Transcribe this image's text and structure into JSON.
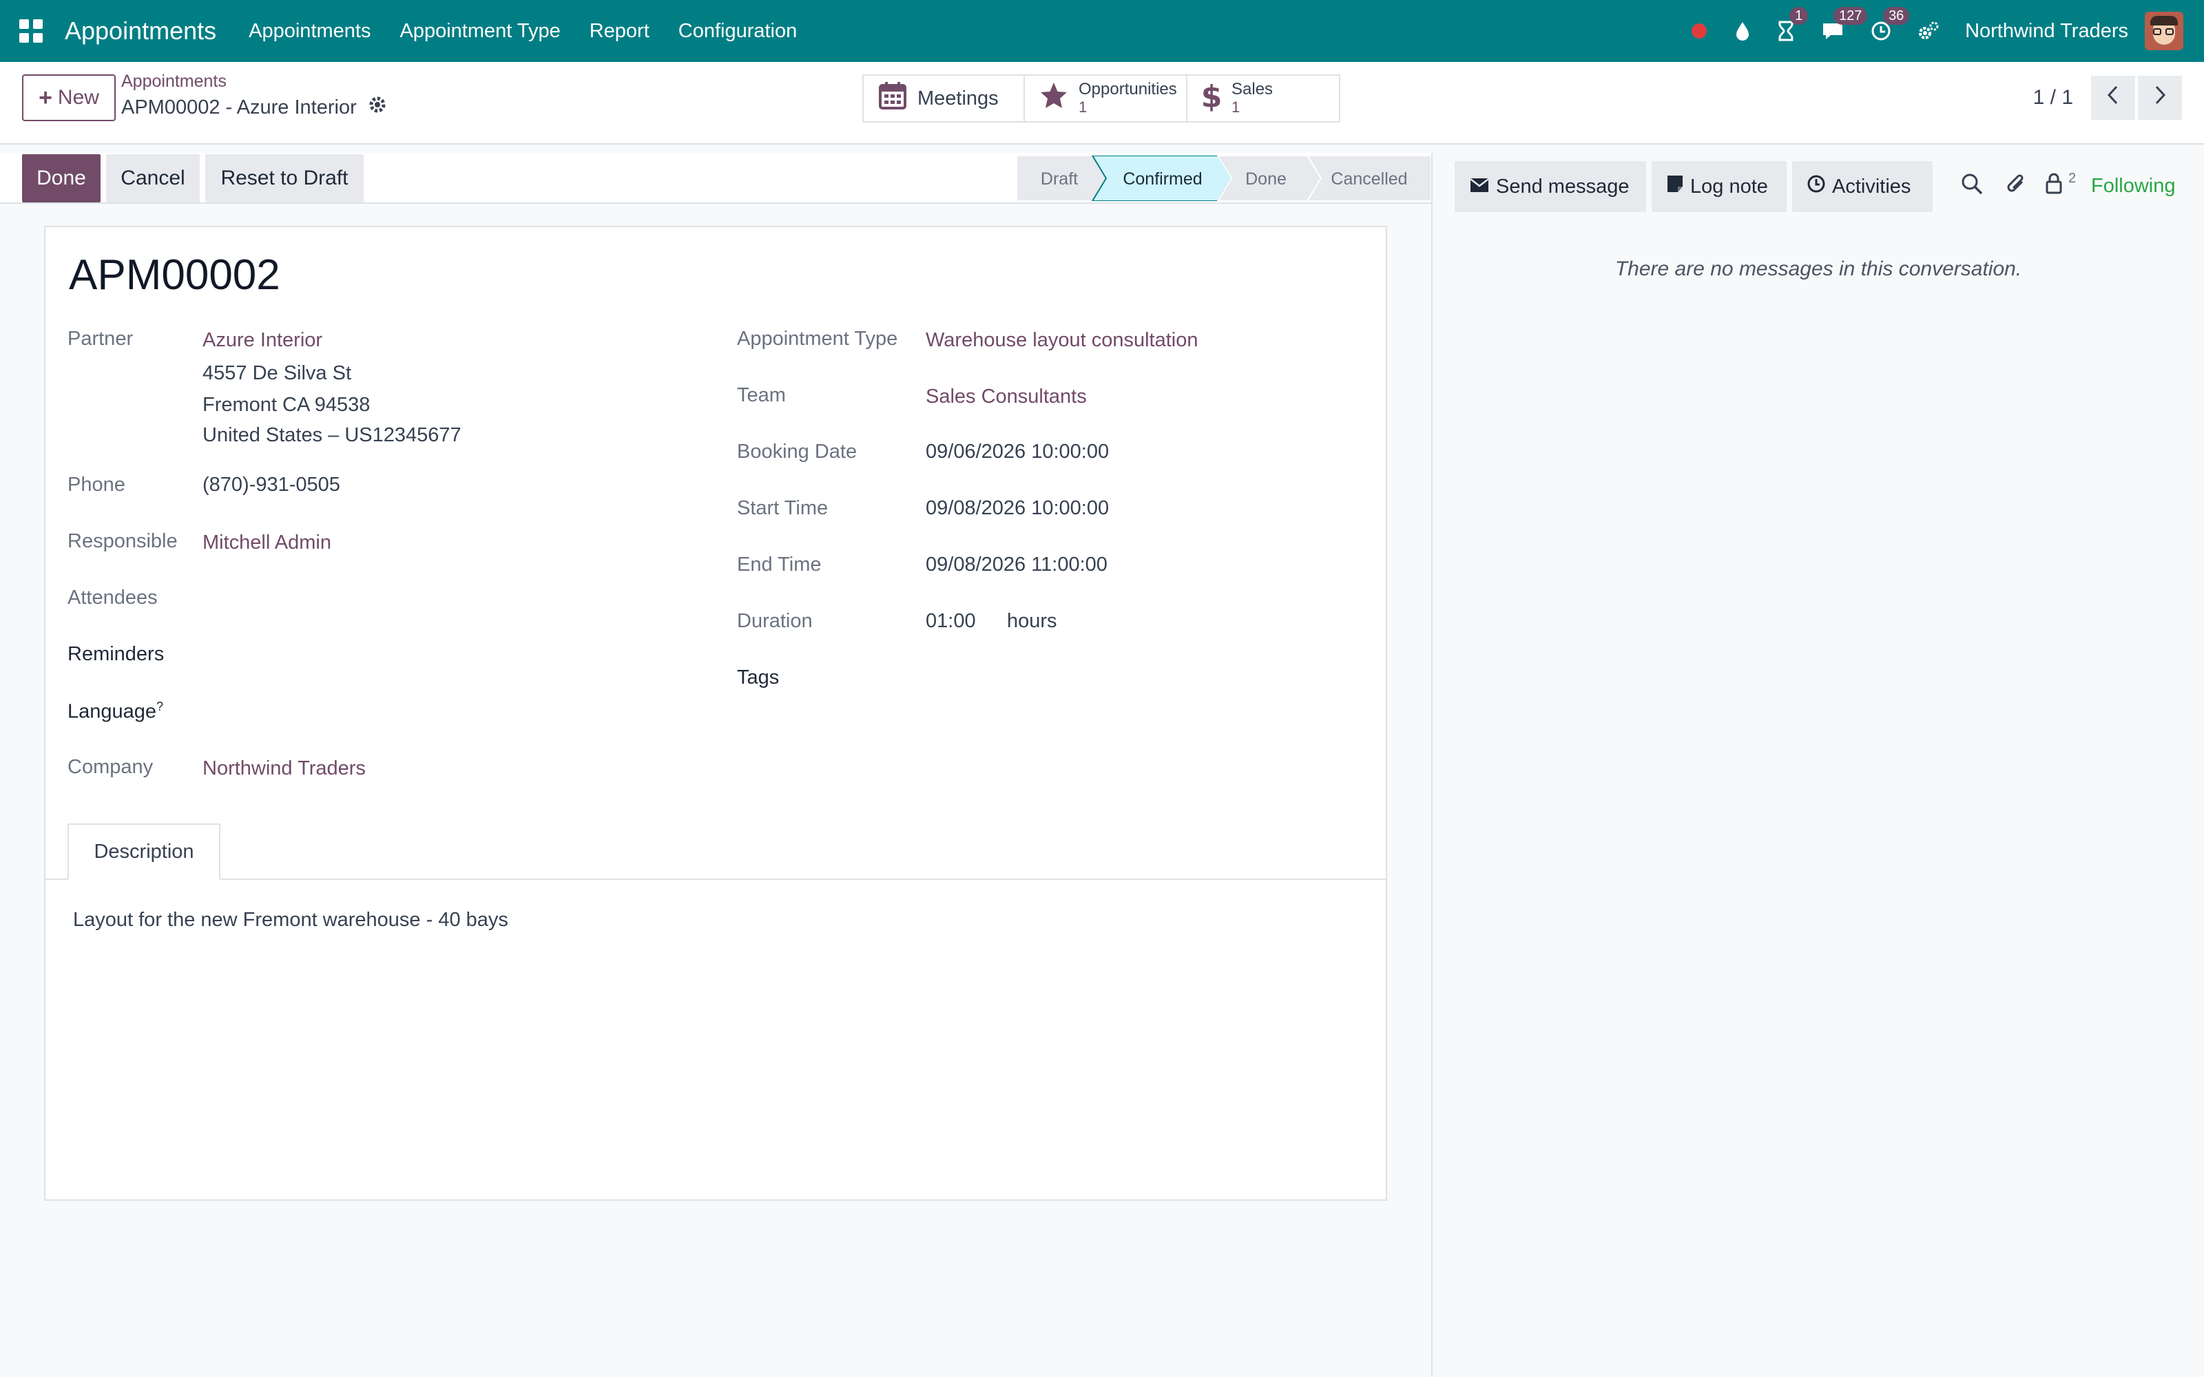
{
  "navbar": {
    "brand": "Appointments",
    "menu": [
      "Appointments",
      "Appointment Type",
      "Report",
      "Configuration"
    ],
    "activity_badge": "1",
    "messages_badge": "127",
    "clock_badge": "36",
    "company": "Northwind Traders"
  },
  "control_panel": {
    "new_label": "New",
    "breadcrumb": "Appointments",
    "record_title": "APM00002 - Azure Interior",
    "smart_buttons": {
      "meetings": "Meetings",
      "opportunities_label": "Opportunities",
      "opportunities_count": "1",
      "sales_label": "Sales",
      "sales_count": "1"
    },
    "pager": "1 / 1"
  },
  "statusbar": {
    "buttons": [
      "Done",
      "Cancel",
      "Reset to Draft"
    ],
    "stages": [
      "Draft",
      "Confirmed",
      "Done",
      "Cancelled"
    ],
    "current_stage": "Confirmed"
  },
  "form": {
    "reference": "APM00002",
    "left": {
      "partner_label": "Partner",
      "partner_name": "Azure Interior",
      "address_line1": "4557 De Silva St",
      "address_line2": "Fremont CA 94538",
      "address_line3": "United States – US12345677",
      "phone_label": "Phone",
      "phone": "(870)-931-0505",
      "responsible_label": "Responsible",
      "responsible": "Mitchell Admin",
      "attendees_label": "Attendees",
      "reminders_label": "Reminders",
      "language_label": "Language",
      "language_help": "?",
      "company_label": "Company",
      "company": "Northwind Traders"
    },
    "right": {
      "appointment_type_label": "Appointment Type",
      "appointment_type": "Warehouse layout consultation",
      "team_label": "Team",
      "team": "Sales Consultants",
      "booking_date_label": "Booking Date",
      "booking_date": "09/06/2026 10:00:00",
      "start_time_label": "Start Time",
      "start_time": "09/08/2026 10:00:00",
      "end_time_label": "End Time",
      "end_time": "09/08/2026 11:00:00",
      "duration_label": "Duration",
      "duration": "01:00",
      "duration_unit": "hours",
      "tags_label": "Tags"
    },
    "tab": "Description",
    "description": "Layout for the new Fremont warehouse - 40 bays"
  },
  "chatter": {
    "send_message": "Send message",
    "log_note": "Log note",
    "activities": "Activities",
    "followers_count": "2",
    "following": "Following",
    "empty_text": "There are no messages in this conversation."
  },
  "colors": {
    "navbar": "#017e84",
    "primary": "#714b67",
    "stage_active": "#cff4fc",
    "following": "#28a745"
  }
}
